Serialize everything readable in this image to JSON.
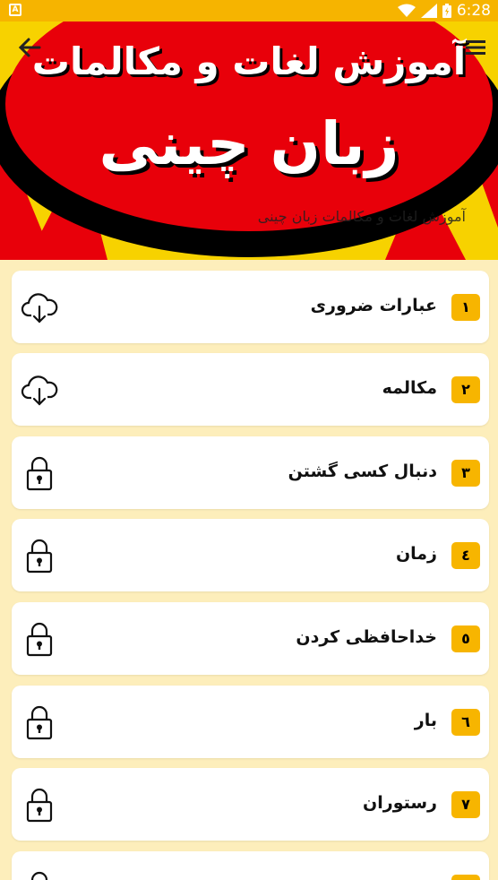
{
  "status_bar": {
    "left_icon_letter": "A",
    "time": "6:28",
    "icons": [
      "wifi-icon",
      "signal-icon",
      "battery-icon"
    ]
  },
  "header": {
    "banner_line1": "آموزش لغات و مکالمات",
    "banner_line2": "زبان چینی",
    "subtitle": "آموزش لغات و مکالمات زبان چینی",
    "back_icon": "arrow-left-icon",
    "menu_icon": "menu-icon"
  },
  "colors": {
    "status_bar": "#f6b400",
    "background": "#fdeebb",
    "number_badge": "#f7b500",
    "banner_red": "#e8000a",
    "banner_yellow": "#f7d200"
  },
  "items": [
    {
      "number": "١",
      "title": "عبارات ضروری",
      "icon": "cloud-download-icon"
    },
    {
      "number": "٢",
      "title": "مکالمه",
      "icon": "cloud-download-icon"
    },
    {
      "number": "٣",
      "title": "دنبال کسی گشتن",
      "icon": "lock-icon"
    },
    {
      "number": "٤",
      "title": "زمان",
      "icon": "lock-icon"
    },
    {
      "number": "٥",
      "title": "خداحافظی کردن",
      "icon": "lock-icon"
    },
    {
      "number": "٦",
      "title": "بار",
      "icon": "lock-icon"
    },
    {
      "number": "٧",
      "title": "رستوران",
      "icon": "lock-icon"
    },
    {
      "number": "",
      "title": "",
      "icon": "lock-icon"
    }
  ]
}
